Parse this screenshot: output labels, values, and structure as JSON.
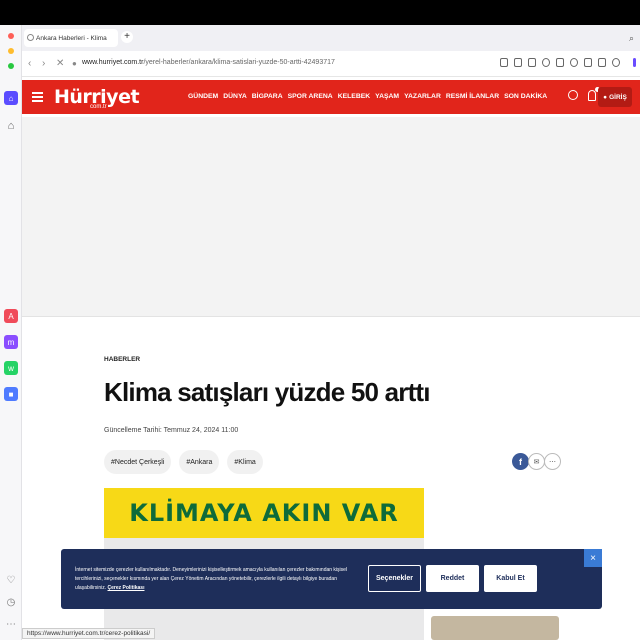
{
  "browser": {
    "tab_title": "Ankara Haberleri - Klima",
    "url_domain": "www.hurriyet.com.tr",
    "url_path": "/yerel-haberler/ankara/klima-satislari-yuzde-50-artti-42493717",
    "status_url": "https://www.hurriyet.com.tr/cerez-politikasi/"
  },
  "header": {
    "logo": "Hürriyet",
    "logo_sub": "com.tr",
    "nav": [
      "GÜNDEM",
      "DÜNYA",
      "BİGPARA",
      "SPOR ARENA",
      "KELEBEK",
      "YAŞAM",
      "YAZARLAR",
      "RESMİ İLANLAR",
      "SON DAKİKA"
    ],
    "login_label": "GİRİŞ"
  },
  "article": {
    "category": "HABERLER",
    "title": "Klima satışları yüzde 50 arttı",
    "updated": "Güncelleme Tarihi: Temmuz 24, 2024 11:00",
    "tags": [
      "#Necdet Çerkeşli",
      "#Ankara",
      "#Klima"
    ],
    "hero_text": "KLİMAYA AKIN VAR"
  },
  "cookie": {
    "text": "İnternet sitemizde çerezler kullanılmaktadır. Deneyimlerinizi kişiselleştirmek amacıyla kullanılan çerezler bakımından kişisel tercihlerinizi, seçenekler kısmında yer alan Çerez Yönetim Aracından yönetebilir, çerezlerle ilgili detaylı bilgiye buradan ulaşabilirsiniz.",
    "link": "Çerez Politikası",
    "options_label": "Seçenekler",
    "reject_label": "Reddet",
    "accept_label": "Kabul Et",
    "close_label": "×"
  },
  "colors": {
    "brand_red": "#e1251b",
    "cookie_bg": "#1e2e5a",
    "hero_yellow": "#f7d917",
    "hero_green": "#0e6b3a",
    "facebook": "#3b5998"
  }
}
